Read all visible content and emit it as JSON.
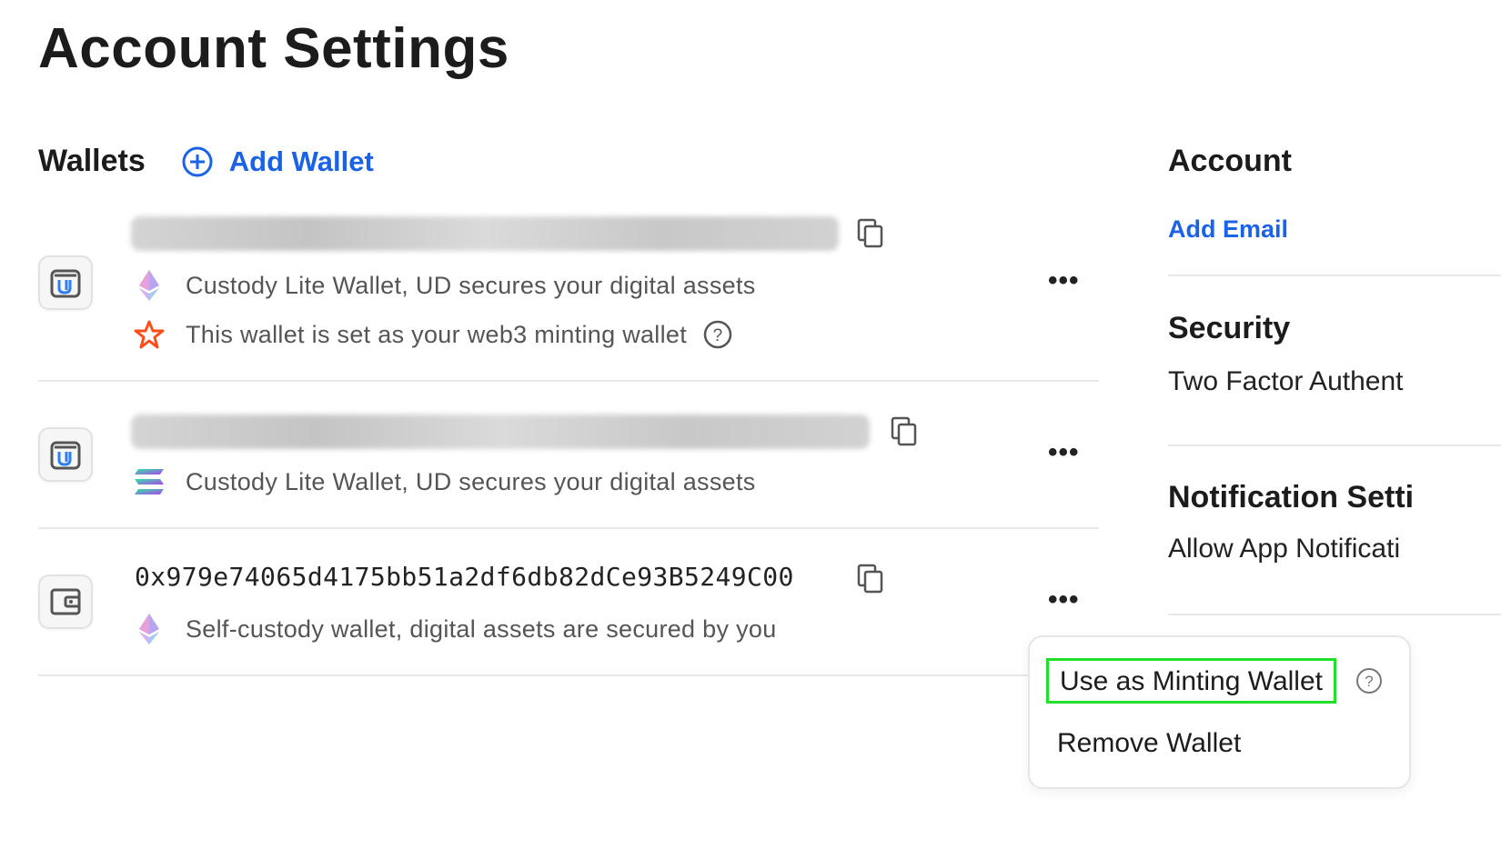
{
  "page": {
    "title": "Account Settings"
  },
  "wallets": {
    "title": "Wallets",
    "add_label": "Add Wallet",
    "items": [
      {
        "address": "",
        "address_hidden": true,
        "lines": [
          {
            "icon": "ethereum-icon",
            "text": "Custody Lite Wallet, UD secures your digital assets"
          },
          {
            "icon": "star-icon",
            "text": "This wallet is set as your web3 minting wallet",
            "help": true
          }
        ],
        "more": "•••"
      },
      {
        "address": "",
        "address_hidden": true,
        "lines": [
          {
            "icon": "solana-icon",
            "text": "Custody Lite Wallet, UD secures your digital assets"
          }
        ],
        "more": "•••"
      },
      {
        "address": "0x979e74065d4175bb51a2df6db82dCe93B5249C00",
        "address_hidden": false,
        "lines": [
          {
            "icon": "ethereum-icon",
            "text": "Self-custody wallet, digital assets are secured by you"
          }
        ],
        "more": "•••"
      }
    ]
  },
  "sidebar": {
    "account": {
      "title": "Account",
      "link": "Add Email"
    },
    "security": {
      "title": "Security",
      "text": "Two Factor Authent"
    },
    "notifications": {
      "title": "Notification Setti",
      "text": "Allow App Notificati"
    }
  },
  "menu": {
    "items": [
      {
        "label": "Use as Minting Wallet",
        "highlighted": true
      },
      {
        "label": "Remove Wallet"
      }
    ]
  },
  "colors": {
    "accent": "#1b63e6",
    "highlight": "#22e02a",
    "star": "#ff4d1a"
  }
}
